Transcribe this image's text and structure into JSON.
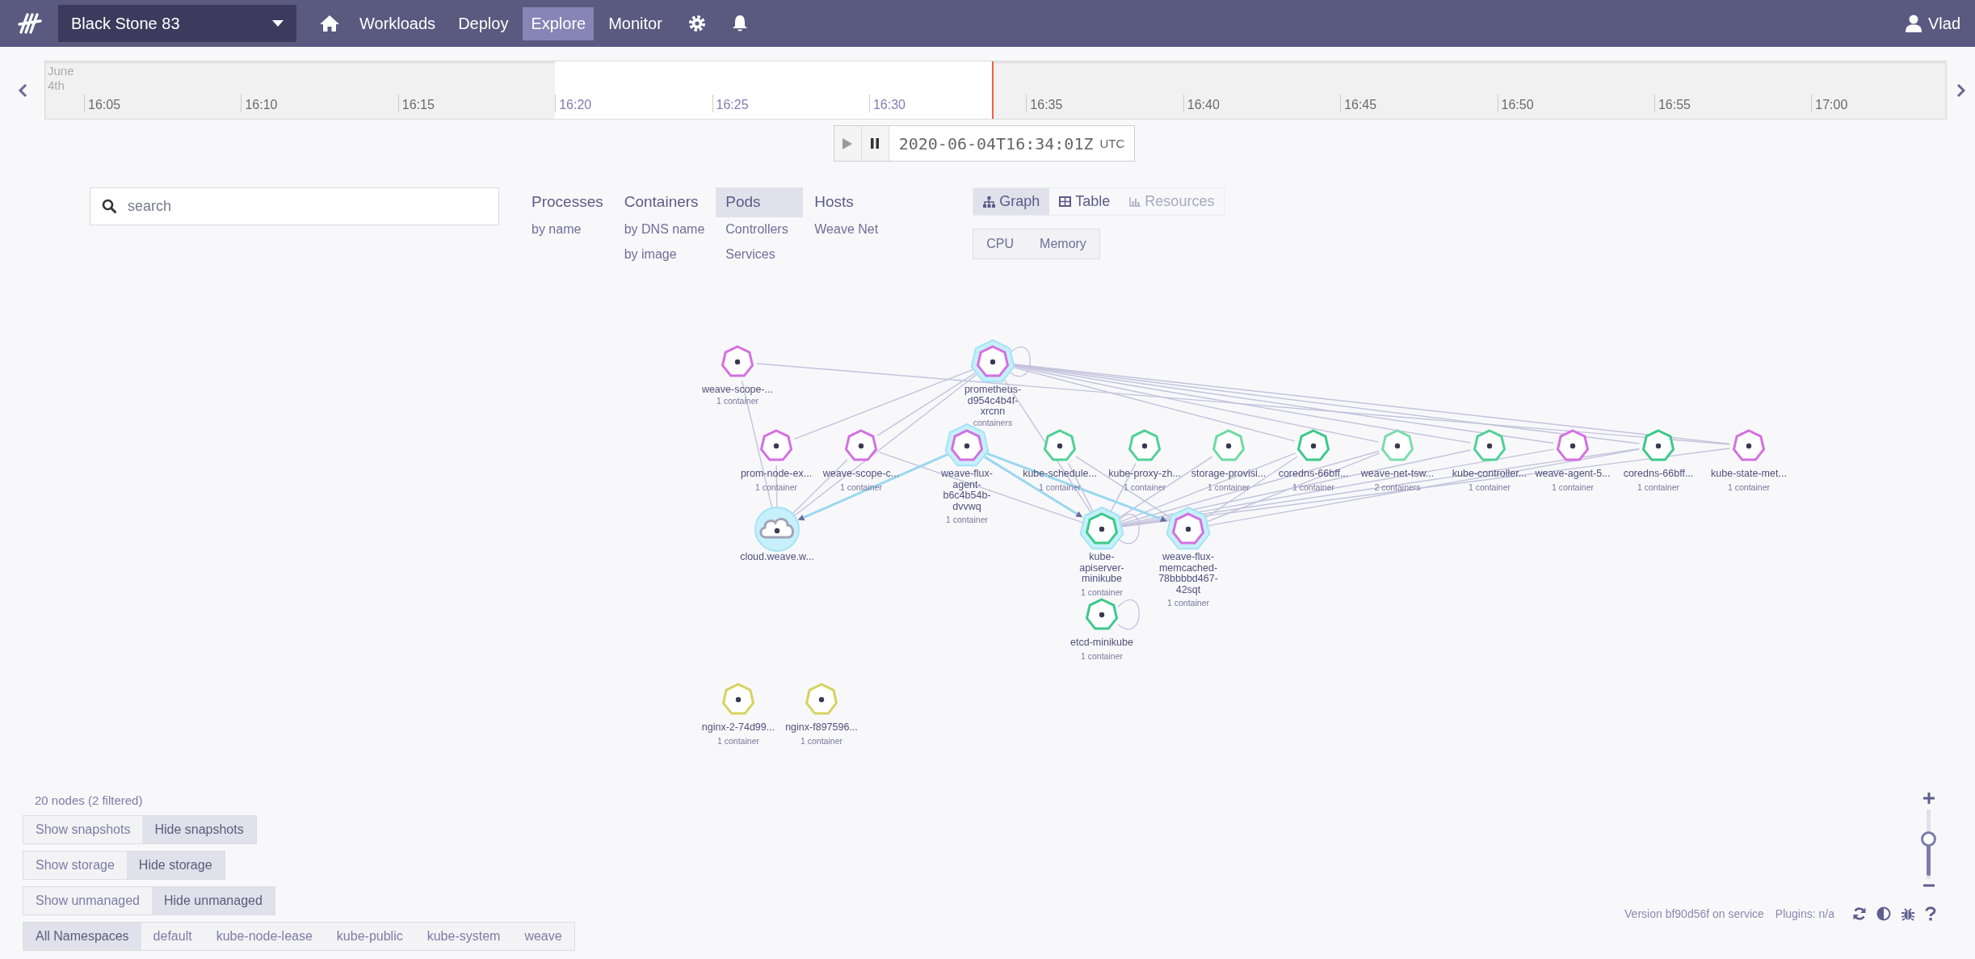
{
  "top_bar": {
    "workspace": "Black Stone 83",
    "nav": [
      {
        "label": "Workloads",
        "selected": false
      },
      {
        "label": "Deploy",
        "selected": false
      },
      {
        "label": "Explore",
        "selected": true
      },
      {
        "label": "Monitor",
        "selected": false
      }
    ],
    "user": "Vlad"
  },
  "timeline": {
    "date": [
      "June",
      "4th"
    ],
    "level": 0.4985,
    "ticks": [
      {
        "label": "16:05",
        "highlighted": false
      },
      {
        "label": "16:10",
        "highlighted": false
      },
      {
        "label": "16:15",
        "highlighted": false
      },
      {
        "label": "16:20",
        "highlighted": true
      },
      {
        "label": "16:25",
        "highlighted": true
      },
      {
        "label": "16:30",
        "highlighted": true
      },
      {
        "label": "16:35",
        "highlighted": false
      },
      {
        "label": "16:40",
        "highlighted": false
      },
      {
        "label": "16:45",
        "highlighted": false
      },
      {
        "label": "16:50",
        "highlighted": false
      },
      {
        "label": "16:55",
        "highlighted": false
      },
      {
        "label": "17:00",
        "highlighted": false
      }
    ]
  },
  "time_controls": {
    "timestamp": "2020-06-04T16:34:01Z",
    "timezone": "UTC"
  },
  "search": {
    "placeholder": "search"
  },
  "topologies": [
    {
      "label": "Processes",
      "selected": false,
      "children": [
        {
          "label": "by name",
          "selected": false
        }
      ]
    },
    {
      "label": "Containers",
      "selected": false,
      "children": [
        {
          "label": "by DNS name",
          "selected": false
        },
        {
          "label": "by image",
          "selected": false
        }
      ]
    },
    {
      "label": "Pods",
      "selected": true,
      "children": [
        {
          "label": "Controllers",
          "selected": false
        },
        {
          "label": "Services",
          "selected": false
        }
      ]
    },
    {
      "label": "Hosts",
      "selected": false,
      "children": [
        {
          "label": "Weave Net",
          "selected": false
        }
      ]
    }
  ],
  "view_modes": [
    {
      "label": "Graph",
      "kind": "graph",
      "selected": true,
      "disabled": false
    },
    {
      "label": "Table",
      "kind": "table",
      "selected": false,
      "disabled": false
    },
    {
      "label": "Resources",
      "kind": "resources",
      "selected": false,
      "disabled": true
    }
  ],
  "metrics": [
    {
      "label": "CPU",
      "selected": false
    },
    {
      "label": "Memory",
      "selected": false
    }
  ],
  "graph": {
    "nodes": [
      {
        "name": "weave-scope-...",
        "detail": "1 container",
        "kind": "pod",
        "color": "#d470e0",
        "highlighted": false
      },
      {
        "name": "prometheus-d954c4b4f-xrcnn",
        "detail": "containers",
        "kind": "pod",
        "color": "#d470e0",
        "highlighted": true
      },
      {
        "name": "prom-node-ex...",
        "detail": "1 container",
        "kind": "pod",
        "color": "#d470e0",
        "highlighted": false
      },
      {
        "name": "weave-scope-c...",
        "detail": "1 container",
        "kind": "pod",
        "color": "#d470e0",
        "highlighted": false
      },
      {
        "name": "weave-flux-agent-b6c4b54b-dvvwq",
        "detail": "1 container",
        "kind": "pod",
        "color": "#d470e0",
        "highlighted": true
      },
      {
        "name": "kube-schedule...",
        "detail": "1 container",
        "kind": "pod",
        "color": "#4fd196",
        "highlighted": false
      },
      {
        "name": "kube-proxy-zh...",
        "detail": "1 container",
        "kind": "pod",
        "color": "#4fd196",
        "highlighted": false
      },
      {
        "name": "storage-provisi...",
        "detail": "1 container",
        "kind": "pod",
        "color": "#6fd9a3",
        "highlighted": false
      },
      {
        "name": "coredns-66bff...",
        "detail": "1 container",
        "kind": "pod",
        "color": "#3cc98a",
        "highlighted": false
      },
      {
        "name": "weave-net-tsw...",
        "detail": "2 containers",
        "kind": "pod",
        "color": "#7bdcad",
        "highlighted": false
      },
      {
        "name": "kube-controller...",
        "detail": "1 container",
        "kind": "pod",
        "color": "#4fd196",
        "highlighted": false
      },
      {
        "name": "weave-agent-5...",
        "detail": "1 container",
        "kind": "pod",
        "color": "#d470e0",
        "highlighted": false
      },
      {
        "name": "coredns-66bff...",
        "detail": "1 container",
        "kind": "pod",
        "color": "#3cc98a",
        "highlighted": false
      },
      {
        "name": "kube-state-met...",
        "detail": "1 container",
        "kind": "pod",
        "color": "#d470e0",
        "highlighted": false
      },
      {
        "name": "cloud.weave.w...",
        "kind": "cloud",
        "color": "#a3a3b5",
        "highlighted": true
      },
      {
        "name": "kube-apiserver-minikube",
        "detail": "1 container",
        "kind": "pod",
        "color": "#3cc98a",
        "highlighted": true
      },
      {
        "name": "weave-flux-memcached-78bbbbd467-42sqt",
        "detail": "1 container",
        "kind": "pod",
        "color": "#d470e0",
        "highlighted": true
      },
      {
        "name": "etcd-minikube",
        "detail": "1 container",
        "kind": "pod",
        "color": "#3cc98a",
        "highlighted": false
      },
      {
        "name": "nginx-2-74d99...",
        "detail": "1 container",
        "kind": "pod",
        "color": "#d6d35e",
        "highlighted": false
      },
      {
        "name": "nginx-f897596...",
        "detail": "1 container",
        "kind": "pod",
        "color": "#d6d35e",
        "highlighted": false
      }
    ]
  },
  "node_count": "20 nodes (2 filtered)",
  "toggles": [
    {
      "options": [
        {
          "label": "Show snapshots",
          "selected": false
        },
        {
          "label": "Hide snapshots",
          "selected": true
        }
      ]
    },
    {
      "options": [
        {
          "label": "Show storage",
          "selected": false
        },
        {
          "label": "Hide storage",
          "selected": true
        }
      ]
    },
    {
      "options": [
        {
          "label": "Show unmanaged",
          "selected": false
        },
        {
          "label": "Hide unmanaged",
          "selected": true
        }
      ]
    }
  ],
  "namespaces": [
    {
      "label": "All Namespaces",
      "selected": true
    },
    {
      "label": "default",
      "selected": false
    },
    {
      "label": "kube-node-lease",
      "selected": false
    },
    {
      "label": "kube-public",
      "selected": false
    },
    {
      "label": "kube-system",
      "selected": false
    },
    {
      "label": "weave",
      "selected": false
    }
  ],
  "zoom": {
    "level": 0.6
  },
  "footer": {
    "version": "Version bf90d56f on service",
    "plugins": "Plugins: n/a"
  }
}
